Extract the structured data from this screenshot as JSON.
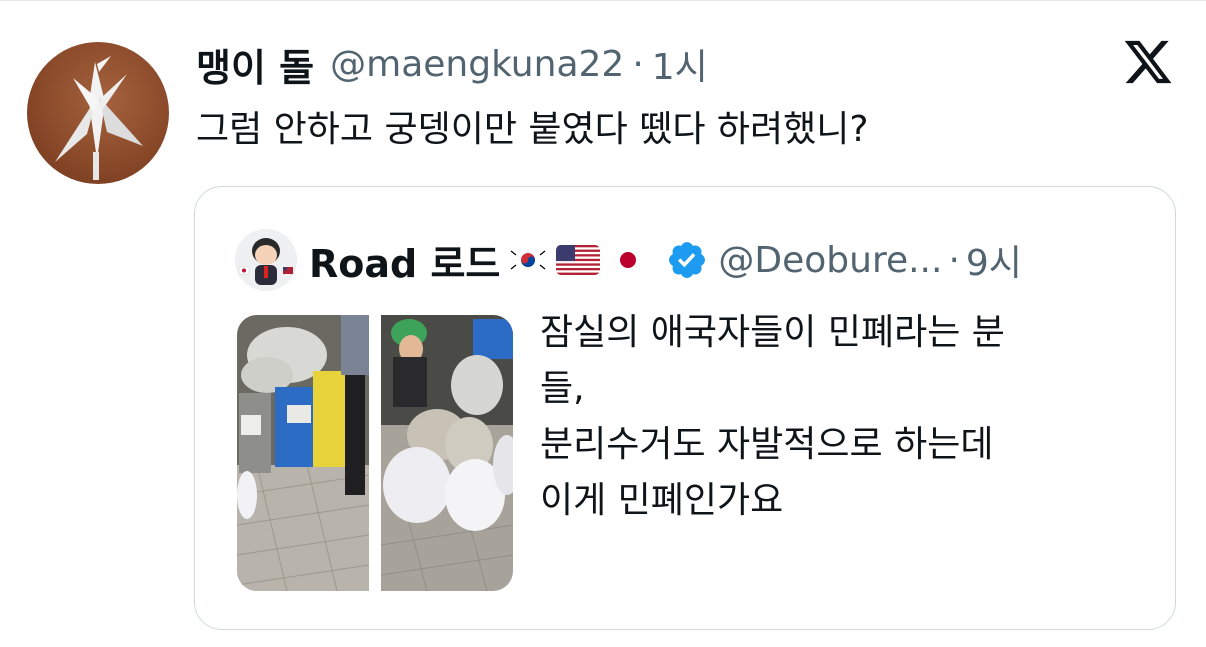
{
  "tweet": {
    "display_name": "맹이 돌",
    "handle": "@maengkuna22",
    "separator": "·",
    "time": "1시",
    "text": "그럼 안하고 궁뎅이만 붙였다 뗐다 하려했니?"
  },
  "quote": {
    "display_name": "Road 로드",
    "flags": [
      "south-korea-flag",
      "usa-flag",
      "japan-flag"
    ],
    "verified_icon": "verified-badge-icon",
    "handle": "@Deobure...",
    "separator": "·",
    "time": "9시",
    "text_lines": [
      "잠실의 애국자들이 민폐라는 분",
      "들,",
      "분리수거도 자발적으로 하는데",
      "이게 민폐인가요"
    ]
  },
  "colors": {
    "text_primary": "#0f1419",
    "text_secondary": "#536471",
    "verified_blue": "#1d9bf0",
    "card_border": "#cfd9de"
  },
  "icons": {
    "platform_logo": "x-logo-icon"
  }
}
